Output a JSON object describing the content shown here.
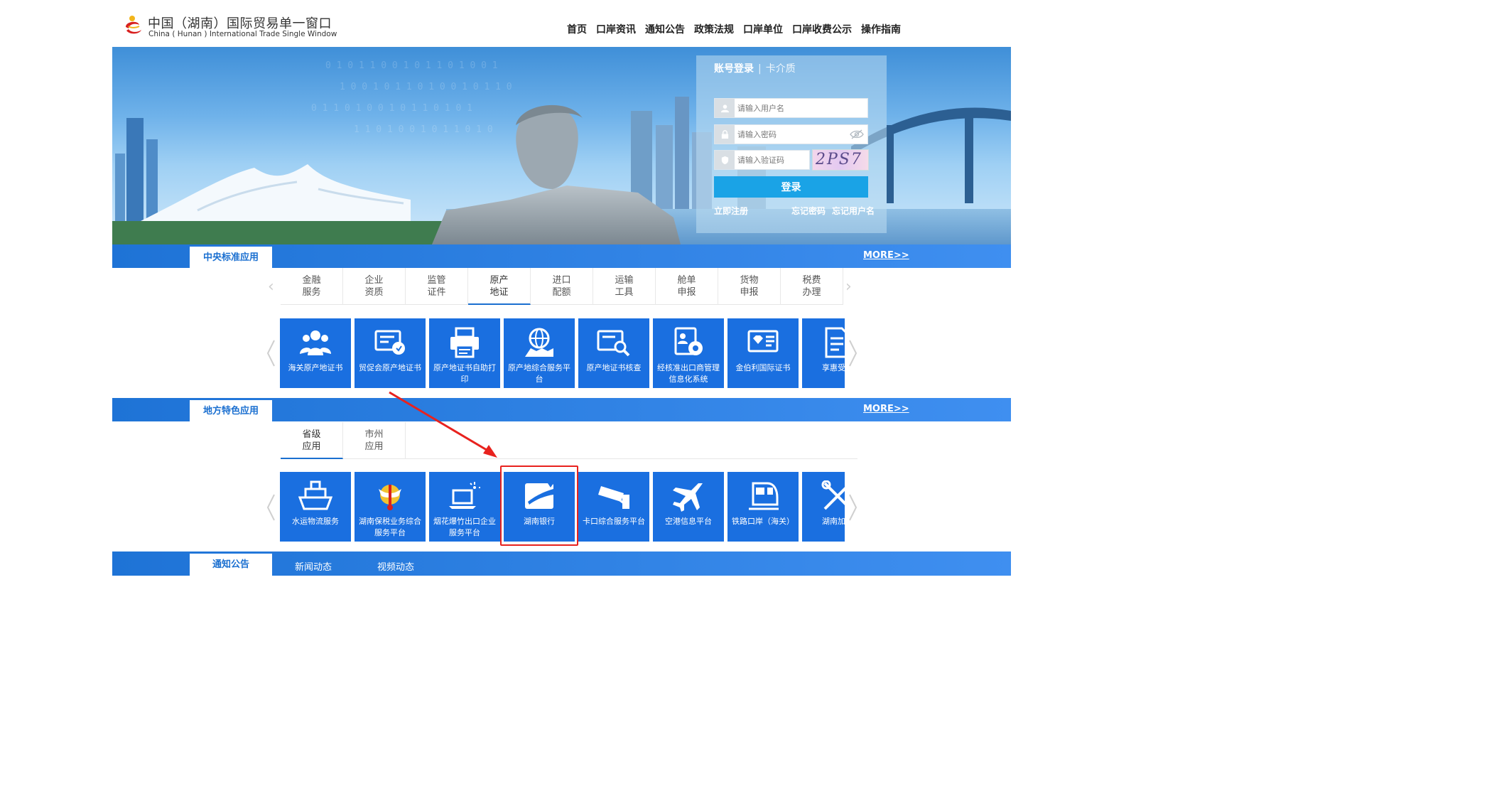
{
  "header": {
    "logo_cn": "中国（湖南）国际贸易单一窗口",
    "logo_en": "China ( Hunan ) International Trade Single Window",
    "nav": [
      "首页",
      "口岸资讯",
      "通知公告",
      "政策法规",
      "口岸单位",
      "口岸收费公示",
      "操作指南"
    ]
  },
  "login": {
    "tab_active": "账号登录",
    "tab_other": "卡介质",
    "username_placeholder": "请输入用户名",
    "password_placeholder": "请输入密码",
    "captcha_placeholder": "请输入验证码",
    "captcha_text": "2PS7",
    "submit": "登录",
    "register": "立即注册",
    "forgot_password": "忘记密码",
    "forgot_username": "忘记用户名"
  },
  "central": {
    "title": "中央标准应用",
    "more": "MORE>>",
    "categories": [
      [
        "金融",
        "服务"
      ],
      [
        "企业",
        "资质"
      ],
      [
        "监管",
        "证件"
      ],
      [
        "原产",
        "地证"
      ],
      [
        "进口",
        "配额"
      ],
      [
        "运输",
        "工具"
      ],
      [
        "舱单",
        "申报"
      ],
      [
        "货物",
        "申报"
      ],
      [
        "税费",
        "办理"
      ]
    ],
    "active_category": 3,
    "tiles": [
      "海关原产地证书",
      "贸促会原产地证书",
      "原产地证书自助打印",
      "原产地综合服务平台",
      "原产地证书核查",
      "经核准出口商管理信息化系统",
      "金伯利国际证书",
      "享惠受理"
    ]
  },
  "local": {
    "title": "地方特色应用",
    "more": "MORE>>",
    "categories": [
      [
        "省级",
        "应用"
      ],
      [
        "市州",
        "应用"
      ]
    ],
    "active_category": 0,
    "tiles": [
      "水运物流服务",
      "湖南保税业务综合服务平台",
      "烟花爆竹出口企业服务平台",
      "湖南银行",
      "卡口综合服务平台",
      "空港信息平台",
      "铁路口岸（海关）",
      "湖南加贸"
    ]
  },
  "news": {
    "tabs": [
      "通知公告",
      "新闻动态",
      "视频动态"
    ]
  },
  "colors": {
    "tile_blue": "#1a6fe0",
    "bar_blue": "#2a80e8",
    "highlight_red": "#e8221e",
    "login_button": "#1aa3e6"
  }
}
